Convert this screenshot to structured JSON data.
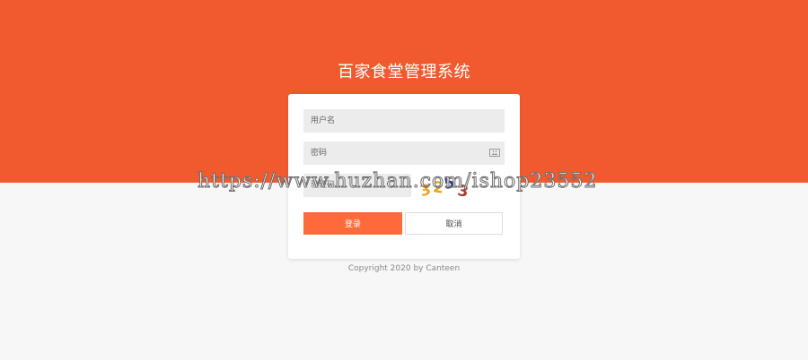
{
  "colors": {
    "primary": "#f15a2f",
    "login_button": "#ff6a3a",
    "page_background": "#f7f7f7"
  },
  "header": {
    "title": "百家食堂管理系统"
  },
  "login_form": {
    "username_placeholder": "用户名",
    "password_placeholder": "密码",
    "password_icon": "keyboard-icon",
    "captcha_placeholder": "验证码",
    "captcha_image": {
      "chars": [
        {
          "text": "3",
          "color": "#f0a41d"
        },
        {
          "text": "2",
          "color": "#e6a417"
        },
        {
          "text": "5",
          "color": "#2b3d8f"
        },
        {
          "text": "3",
          "color": "#b33a2a"
        }
      ]
    },
    "login_label": "登录",
    "cancel_label": "取消"
  },
  "footer": {
    "copyright": "Copyright 2020 by Canteen"
  },
  "watermark": {
    "text": "https://www.huzhan.com/ishop23552"
  }
}
